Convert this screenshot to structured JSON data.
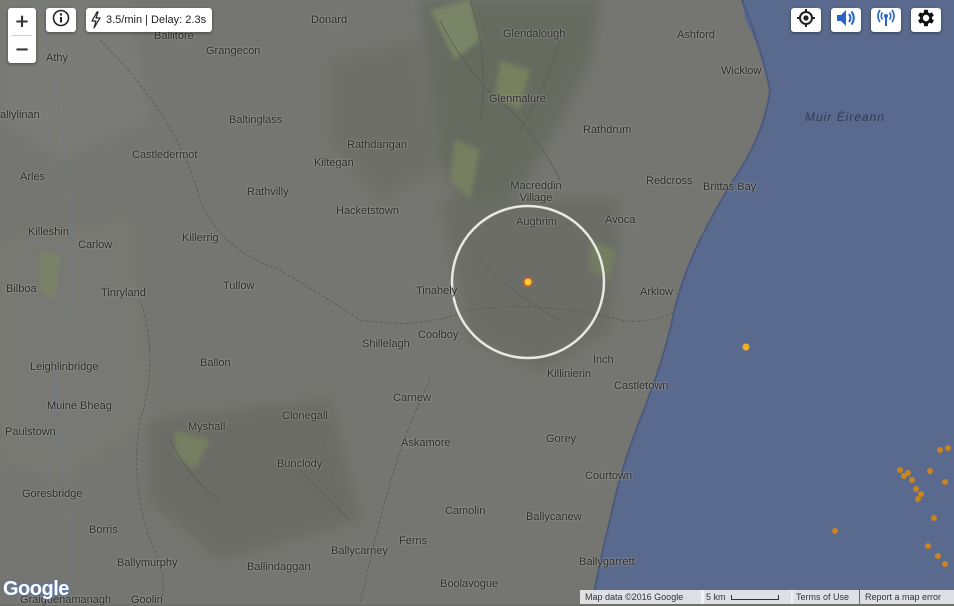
{
  "map": {
    "sea_label": "Muir Éireann",
    "land_color": "#757571",
    "sea_color": "#5a6a8e",
    "mountain_color": "#5d6b4f",
    "place_names": [
      "Donard",
      "Ballitore",
      "Grangecon",
      "Athy",
      "Glendalough",
      "Ashford",
      "Wicklow",
      "allylinan",
      "Baltinglass",
      "Glenmalure",
      "Rathdrum",
      "Castledermot",
      "Rathdangan",
      "Kiltegan",
      "Arles",
      "Rathvilly",
      "Macreddin Village",
      "Redcross",
      "Brittas Bay",
      "Hacketstown",
      "Killeshin",
      "Carlow",
      "Killerrig",
      "Aughrim",
      "Avoca",
      "Bilboa",
      "Tinryland",
      "Tullow",
      "Tinahely",
      "Arklow",
      "Coolboy",
      "Shillelagh",
      "Ballon",
      "Leighlinbridge",
      "Inch",
      "Killinierin",
      "Castletown",
      "Muine Bheag",
      "Carnew",
      "Myshall",
      "Clonegall",
      "Paulstown",
      "Askamore",
      "Gorey",
      "Bunclody",
      "Courtown",
      "Goresbridge",
      "Camolin",
      "Ballycanew",
      "Borris",
      "Ferns",
      "Ballymurphy",
      "Ballycarney",
      "Ballindaggan",
      "Ballygarrett",
      "Boolavogue",
      "Graiguenamanagh",
      "Goolin"
    ]
  },
  "controls": {
    "zoom_in": "+",
    "zoom_out": "−",
    "rate_text": "3.5/min | Delay: 2.3s"
  },
  "icons": {
    "info": "info-icon",
    "lightning": "lightning-icon",
    "locate": "locate-icon",
    "sound": "speaker-icon",
    "signal": "signal-icon",
    "settings": "gear-icon"
  },
  "strikes": {
    "fresh_color": "#ffd23a",
    "old_color": "#c8841e",
    "old_strike_count": 16
  },
  "footer": {
    "map_data": "Map data ©2016 Google",
    "scale": "5 km",
    "terms": "Terms of Use",
    "report": "Report a map error"
  },
  "logo": "Google"
}
